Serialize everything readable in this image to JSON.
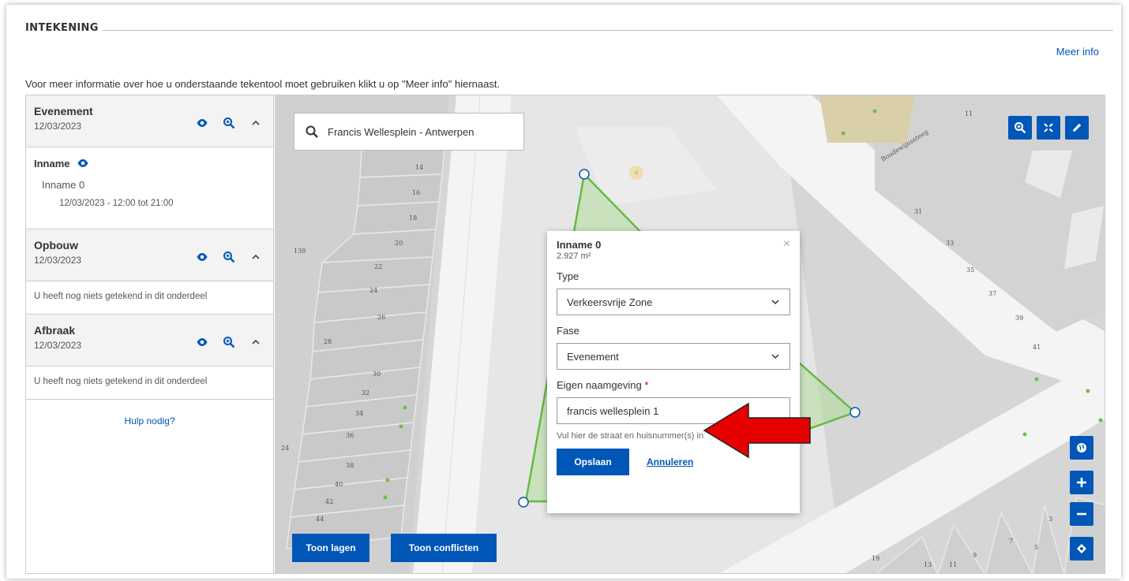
{
  "section": {
    "title": "INTEKENING",
    "meer_info": "Meer info",
    "intro": "Voor meer informatie over hoe u onderstaande tekentool moet gebruiken klikt u op \"Meer info\" hiernaast."
  },
  "sidebar": {
    "phases": [
      {
        "name": "Evenement",
        "date": "12/03/2023"
      },
      {
        "name": "Opbouw",
        "date": "12/03/2023"
      },
      {
        "name": "Afbraak",
        "date": "12/03/2023"
      }
    ],
    "inname": {
      "title": "Inname",
      "item": "Inname 0",
      "time": "12/03/2023 - 12:00 tot 21:00"
    },
    "empty_note": "U heeft nog niets getekend in dit onderdeel",
    "help": "Hulp nodig?"
  },
  "map": {
    "search_value": "Francis Wellesplein - Antwerpen",
    "street_label": "Boudewijnssteeg",
    "house_numbers": {
      "n1": "14",
      "n2": "16",
      "n3": "18",
      "n4": "20",
      "n5": "22",
      "n6": "24",
      "n7": "26",
      "n8": "28",
      "n9": "30",
      "n10": "32",
      "n11": "34",
      "n12": "36",
      "n13": "38",
      "n14": "40",
      "n15": "42",
      "n16": "44",
      "n17": "139",
      "n18": "24",
      "n19": "11",
      "n20": "31",
      "n21": "33",
      "n22": "35",
      "n23": "37",
      "n24": "39",
      "n25": "41",
      "n26": "19",
      "n27": "13",
      "n28": "11",
      "n29": "9",
      "n30": "7",
      "n31": "5",
      "n32": "3"
    },
    "btn_toon_lagen": "Toon lagen",
    "btn_toon_conflicten": "Toon conflicten",
    "top_buttons": [
      "zoom-to-icon",
      "fullscreen-icon",
      "edit-icon"
    ],
    "side_buttons": [
      "globe-icon",
      "zoom-in-icon",
      "zoom-out-icon",
      "locate-icon"
    ]
  },
  "popup": {
    "title": "Inname 0",
    "area": "2.927 m²",
    "type_label": "Type",
    "type_value": "Verkeersvrije Zone",
    "fase_label": "Fase",
    "fase_value": "Evenement",
    "name_label": "Eigen naamgeving",
    "required_mark": "*",
    "name_value": "francis wellesplein 1",
    "hint": "Vul hier de straat en huisnummer(s) in",
    "save": "Opslaan",
    "cancel": "Annuleren",
    "close": "×"
  },
  "colors": {
    "accent": "#0057b7",
    "polygon": "#66bb44",
    "arrow": "#e60000"
  }
}
